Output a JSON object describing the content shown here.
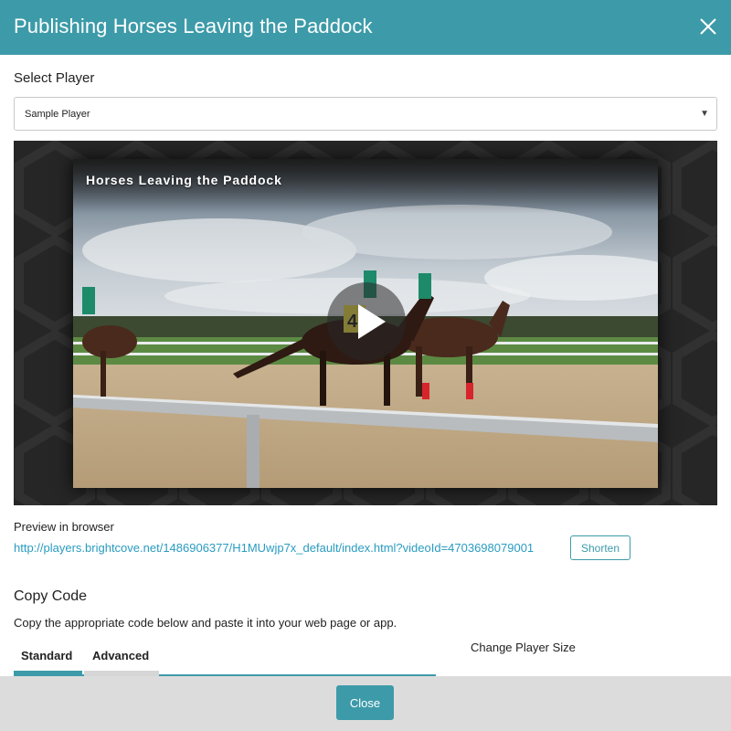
{
  "dialog": {
    "title": "Publishing Horses Leaving the Paddock",
    "close_icon": "close-icon"
  },
  "player_select": {
    "label": "Select Player",
    "selected": "Sample Player",
    "caret": "▼"
  },
  "video": {
    "title": "Horses Leaving the Paddock",
    "play_icon": "play-icon",
    "saddle_number": "4"
  },
  "preview": {
    "label": "Preview in browser",
    "url": "http://players.brightcove.net/1486906377/H1MUwjp7x_default/index.html?videoId=4703698079001",
    "shorten_label": "Shorten"
  },
  "copy_code": {
    "title": "Copy Code",
    "description": "Copy the appropriate code below and paste it into your web page or app.",
    "tabs": [
      {
        "label": "Standard",
        "active": true
      },
      {
        "label": "Advanced",
        "active": false
      }
    ],
    "size_label": "Change Player Size"
  },
  "footer": {
    "close_label": "Close"
  },
  "colors": {
    "accent": "#3d9ba9",
    "link": "#2a9cc1",
    "footer_bg": "#dcdcdc",
    "player_bg": "#262626"
  }
}
